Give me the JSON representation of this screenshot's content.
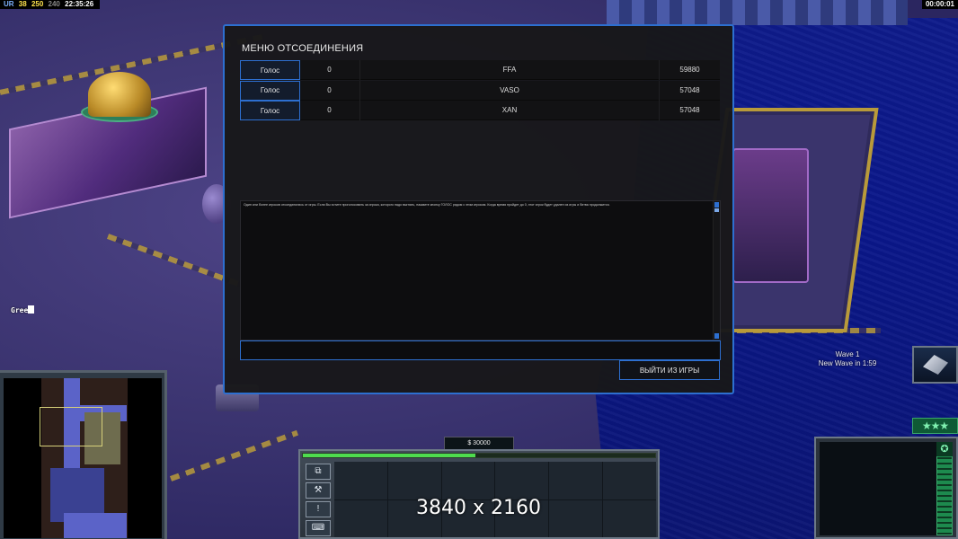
{
  "hud": {
    "stat_a": "UR",
    "stat_b": "38",
    "stat_c": "250",
    "stat_d": "240",
    "clock": "22:35:26",
    "timer": "00:00:01",
    "chat_text": "Gree"
  },
  "dialog": {
    "title": "МЕНЮ ОТСОЕДИНЕНИЯ",
    "players": [
      {
        "vote": "Голос",
        "ping": "0",
        "name": "FFA",
        "frame": "59880"
      },
      {
        "vote": "Голос",
        "ping": "0",
        "name": "VASO",
        "frame": "57048"
      },
      {
        "vote": "Голос",
        "ping": "0",
        "name": "XAN",
        "frame": "57048"
      }
    ],
    "log_text": "Один или более игроков отсоединились от игры. Если Вы хотите проголосовать за игрока, которого надо выгнать, нажмите кнопку ГОЛОС рядом с этим игроком. Когда время пройдет до 0, этот игрок будет удален из игры и битва продолжится.",
    "chat_placeholder": "",
    "exit_button": "ВЫЙТИ ИЗ ИГРЫ"
  },
  "wave": {
    "title": "Wave 1",
    "subtitle": "New Wave in 1:59"
  },
  "panel": {
    "money": "$ 30000",
    "power_level": 0.49,
    "side_buttons": [
      "⧉",
      "⚒",
      "!",
      "⌨"
    ]
  },
  "rank": {
    "stars": "★★★"
  },
  "radar": {
    "star": "✪"
  },
  "watermark": "3840 x 2160"
}
